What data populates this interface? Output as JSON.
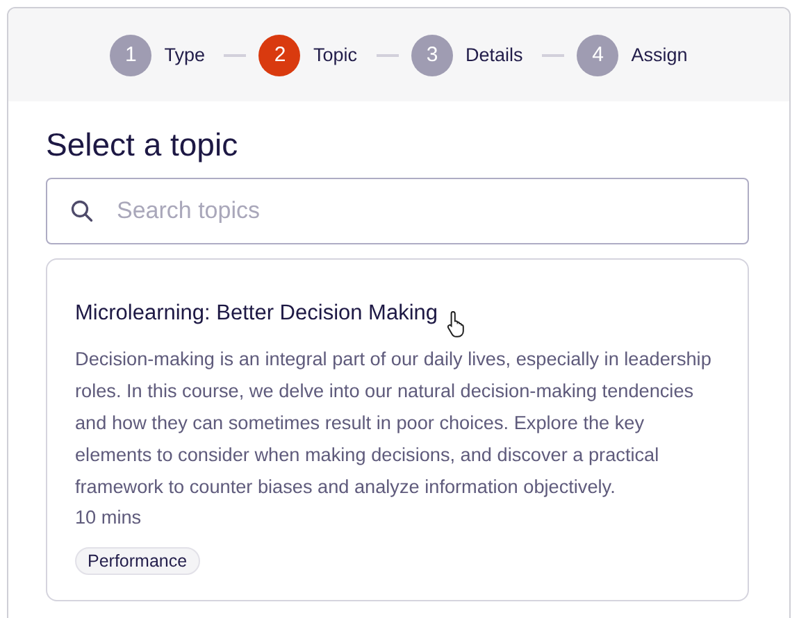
{
  "steps": [
    {
      "number": "1",
      "label": "Type",
      "selected": false
    },
    {
      "number": "2",
      "label": "Topic",
      "selected": true
    },
    {
      "number": "3",
      "label": "Details",
      "selected": false
    },
    {
      "number": "4",
      "label": "Assign",
      "selected": false
    }
  ],
  "heading": "Select a topic",
  "search": {
    "placeholder": "Search topics"
  },
  "topics": [
    {
      "title": "Microlearning: Better Decision Making",
      "description": "Decision-making is an integral part of our daily lives, especially in leadership roles. In this course, we delve into our natural decision-making tendencies and how they can sometimes result in poor choices. Explore the key elements to consider when making decisions, and discover a practical framework to counter biases and analyze information objectively.",
      "duration": "10 mins",
      "tags": [
        "Performance"
      ]
    }
  ]
}
